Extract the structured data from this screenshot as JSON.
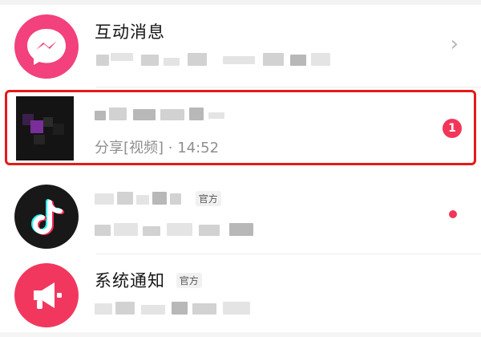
{
  "messages": [
    {
      "title": "互动消息",
      "subtitle": "",
      "trailing": "chevron",
      "trailing_glyph": "›",
      "icon": "message-bubble-icon"
    },
    {
      "title": "",
      "subtitle": "分享[视频] · 14:52",
      "unread_count": "1",
      "icon": "mosaic-avatar"
    },
    {
      "title": "",
      "official_label": "官方",
      "subtitle": "",
      "trailing": "red-dot",
      "icon": "tiktok-note-icon"
    },
    {
      "title": "系统通知",
      "official_label": "官方",
      "subtitle": "",
      "icon": "megaphone-icon"
    }
  ],
  "colors": {
    "accent_red": "#f2365a",
    "interactive_pink": "#f2417c",
    "douyin_black": "#181818",
    "highlight_border": "#e51a1a"
  }
}
